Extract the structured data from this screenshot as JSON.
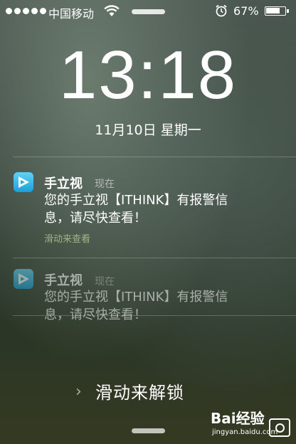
{
  "status_bar": {
    "carrier": "中国移动",
    "battery_percent": "67%",
    "battery_level": 0.67,
    "signal_dots": 5
  },
  "lock": {
    "time": "13:18",
    "date": "11月10日 星期一",
    "slide_to_unlock": "滑动来解锁",
    "slide_chevron": "›"
  },
  "notifications": [
    {
      "app": "手立视",
      "when": "现在",
      "message_line1": "您的手立视【ITHINK】有报警信",
      "message_line2": "息，请尽快查看！",
      "hint": "滑动来查看",
      "icon": "app-play-icon"
    },
    {
      "app": "手立视",
      "when": "现在",
      "message_line1": "您的手立视【ITHINK】有报警信",
      "message_line2": "息，请尽快查看！",
      "icon": "app-play-icon"
    }
  ],
  "watermark": {
    "logo": "Bai经验",
    "url": "jingyan.baidu.com"
  }
}
